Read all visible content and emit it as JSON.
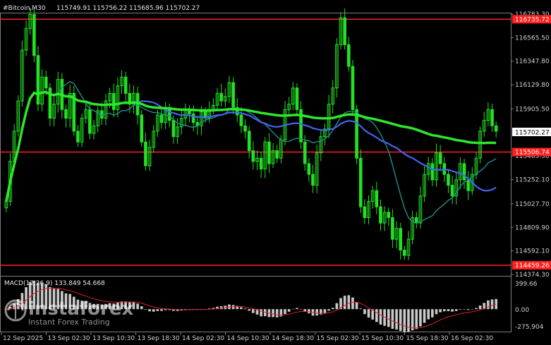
{
  "header": {
    "symbol": "#Bitcoin,M30",
    "ohlc": "115749.91 115756.22 115685.96 115702.27"
  },
  "price_axis": {
    "ticks": [
      "116783.30",
      "116565.50",
      "116347.80",
      "116129.80",
      "115905.50",
      "115469.90",
      "115252.10",
      "115027.70",
      "114809.90",
      "114592.10",
      "114374.30"
    ],
    "current_price": "115702.27",
    "levels": [
      {
        "label": "116735.72",
        "color": "#ff2020"
      },
      {
        "label": "115506.74",
        "color": "#ff2020"
      },
      {
        "label": "114459.26",
        "color": "#ff2020"
      }
    ]
  },
  "time_axis": {
    "labels": [
      "12 Sep 2025",
      "13 Sep 02:30",
      "13 Sep 10:30",
      "13 Sep 18:30",
      "14 Sep 02:30",
      "14 Sep 10:30",
      "14 Sep 18:30",
      "15 Sep 02:30",
      "15 Sep 10:30",
      "15 Sep 18:30",
      "16 Sep 02:30"
    ]
  },
  "macd": {
    "label": "MACD(12,26,9) 133.849 54.668",
    "ticks": [
      "399.66",
      "0.00",
      "-275.904"
    ]
  },
  "watermark": {
    "brand": "instaforex",
    "tagline": "Instant Forex Trading"
  },
  "colors": {
    "candle": "#22e022",
    "ma_fast": "#1f8f8f",
    "ma_mid": "#4466ee",
    "ma_slow": "#2de82d",
    "level": "#ff2020",
    "macd_hist": "#c8c8c8",
    "macd_signal": "#e02020"
  },
  "chart_data": {
    "type": "candlestick",
    "title": "#Bitcoin,M30",
    "ylim": [
      114374.3,
      116783.3
    ],
    "horizontal_levels": [
      116735.72,
      115506.74,
      114459.26
    ],
    "last_price": 115702.27,
    "closes": [
      115050,
      115420,
      115700,
      115980,
      116450,
      116650,
      116780,
      116400,
      115950,
      116200,
      116100,
      115820,
      115950,
      116180,
      115900,
      115820,
      116050,
      115700,
      115600,
      115820,
      115900,
      115680,
      115750,
      115890,
      115820,
      115980,
      116050,
      115900,
      116120,
      116200,
      116050,
      115950,
      116050,
      115850,
      115600,
      115380,
      115550,
      115700,
      115850,
      115780,
      115900,
      115800,
      115650,
      115740,
      115820,
      115900,
      115860,
      115780,
      115750,
      115880,
      115820,
      115900,
      115940,
      116050,
      115980,
      116020,
      116150,
      115920,
      115850,
      115750,
      115700,
      115520,
      115420,
      115450,
      115350,
      115600,
      115400,
      115520,
      115450,
      115620,
      115900,
      115950,
      116100,
      115900,
      115600,
      115400,
      115300,
      115200,
      115500,
      115650,
      115720,
      115950,
      116100,
      116500,
      116750,
      116500,
      116300,
      115900,
      115450,
      115000,
      114900,
      115050,
      115150,
      115000,
      114850,
      114950,
      114900,
      114700,
      114800,
      114600,
      114550,
      114700,
      114900,
      114850,
      115100,
      115300,
      115400,
      115250,
      115500,
      115400,
      115300,
      115200,
      115100,
      115250,
      115400,
      115250,
      115150,
      115300,
      115450,
      115700,
      115800,
      115900,
      115750,
      115700
    ],
    "macd_range": [
      -275.904,
      399.66
    ],
    "macd_value": 133.849,
    "macd_signal_value": 54.668
  }
}
